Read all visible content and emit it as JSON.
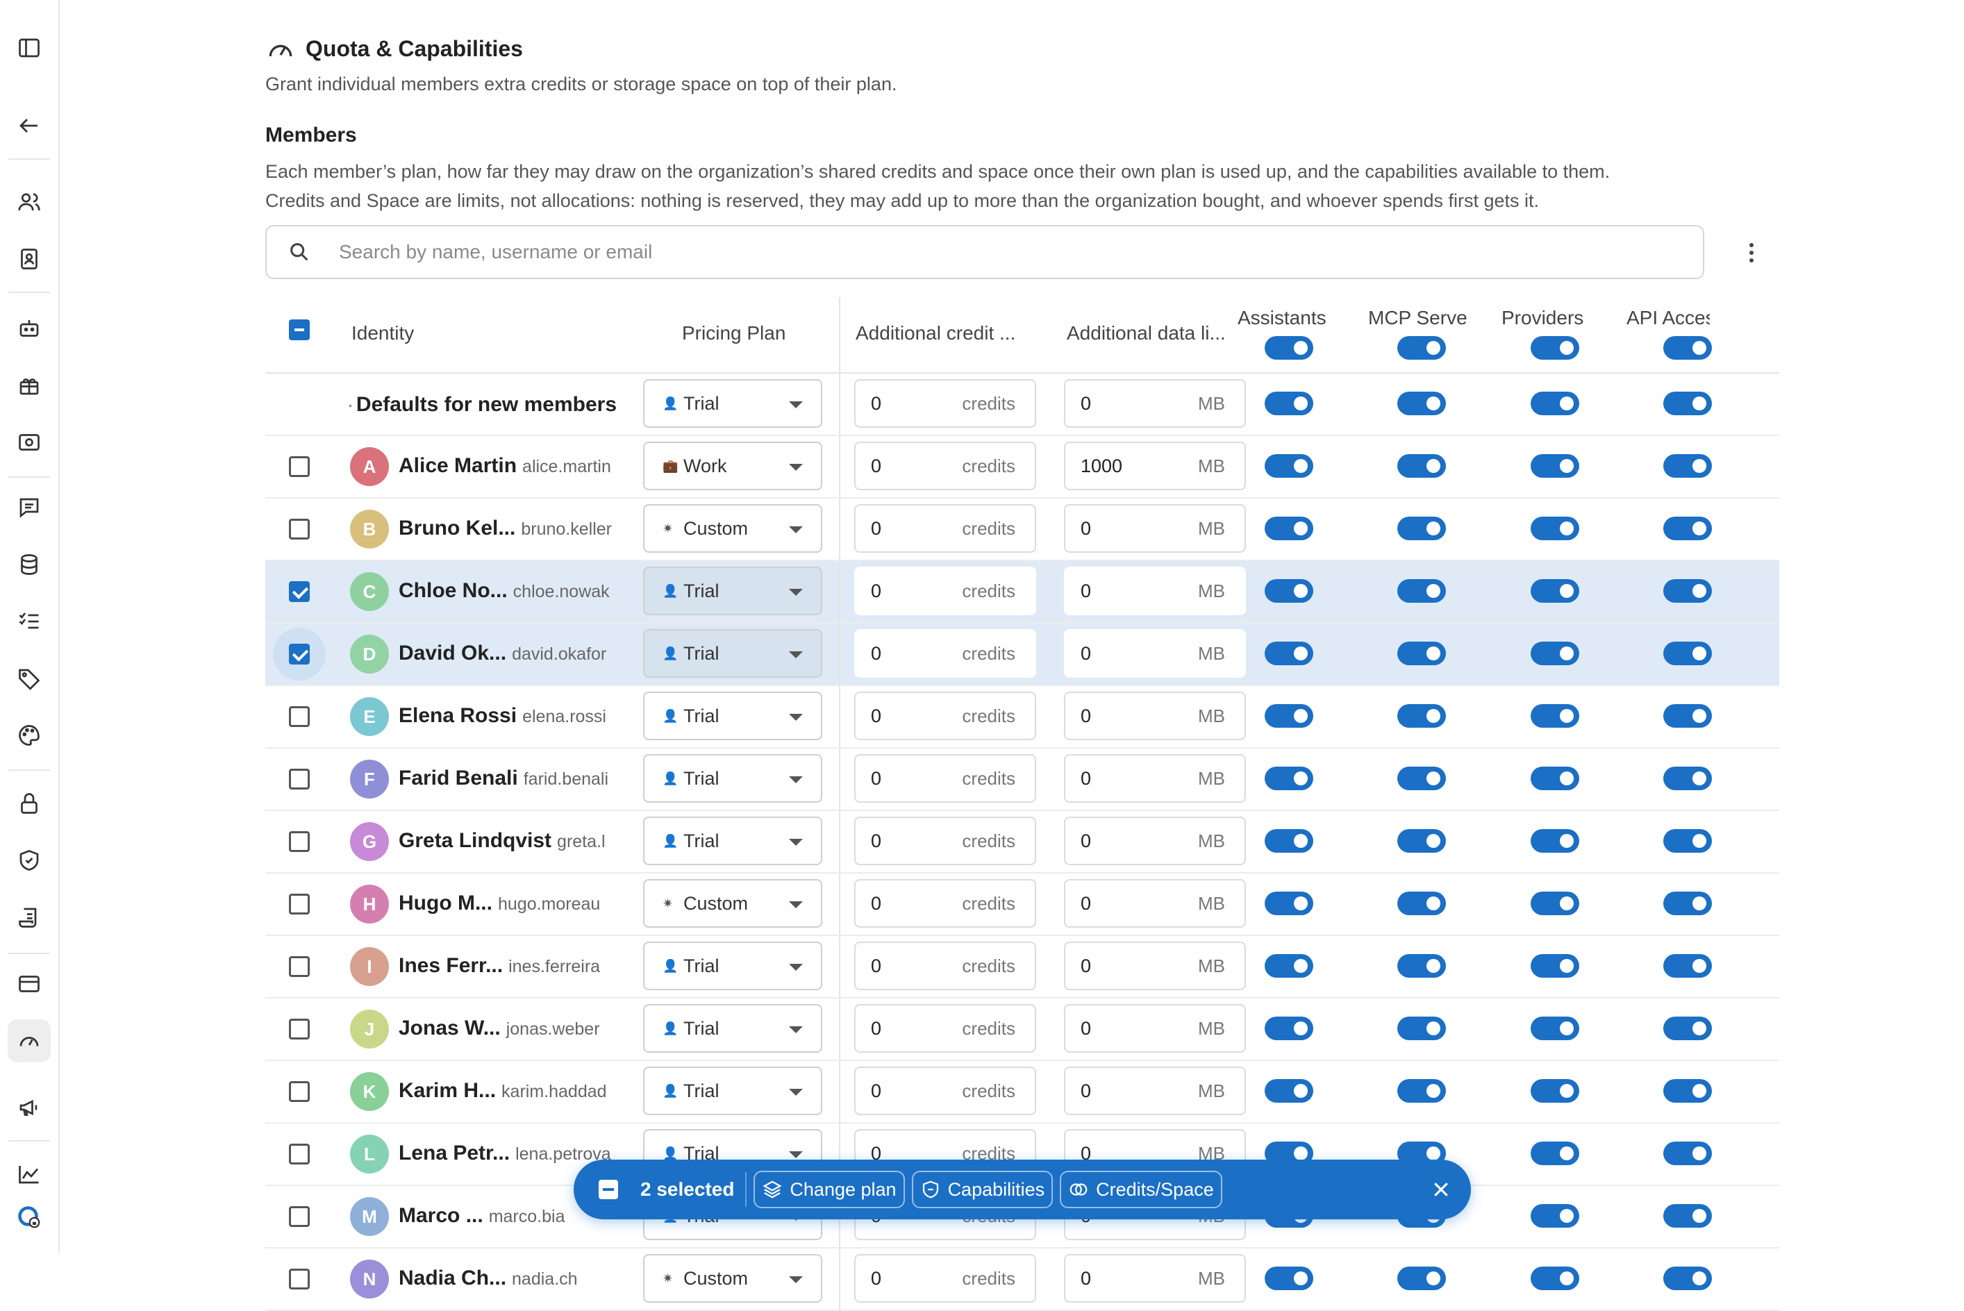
{
  "section": {
    "title": "Quota & Capabilities",
    "description": "Grant individual members extra credits or storage space on top of their plan."
  },
  "members": {
    "title": "Members",
    "desc_line1": "Each member’s plan, how far they may draw on the organization’s shared credits and space once their own plan is used up, and the capabilities available to them.",
    "desc_line2": "Credits and Space are limits, not allocations: nothing is reserved, they may add up to more than the organization bought, and whoever spends first gets it."
  },
  "search": {
    "placeholder": "Search by name, username or email"
  },
  "columns": {
    "identity": "Identity",
    "plan": "Pricing Plan",
    "credits": "Additional credit ...",
    "data": "Additional data li...",
    "assistants": "Assistants",
    "mcp": "MCP Serve",
    "providers": "Providers",
    "api": "API Acces:"
  },
  "defaults_row": {
    "label": "Defaults for new members",
    "plan": "Trial",
    "credits": "0",
    "data": "0"
  },
  "units": {
    "credits": "credits",
    "data": "MB"
  },
  "rows": [
    {
      "initial": "A",
      "name": "Alice Martin",
      "username": "alice.martin",
      "plan": "Work",
      "credits": "0",
      "data": "1000",
      "color": "#d9727a",
      "checked": false
    },
    {
      "initial": "B",
      "name": "Bruno Kel...",
      "username": "bruno.keller",
      "plan": "Custom",
      "credits": "0",
      "data": "0",
      "color": "#d8c07c",
      "checked": false
    },
    {
      "initial": "C",
      "name": "Chloe No...",
      "username": "chloe.nowak",
      "plan": "Trial",
      "credits": "0",
      "data": "0",
      "color": "#8fd0a0",
      "checked": true
    },
    {
      "initial": "D",
      "name": "David Ok...",
      "username": "david.okafor",
      "plan": "Trial",
      "credits": "0",
      "data": "0",
      "color": "#92d3a3",
      "checked": true
    },
    {
      "initial": "E",
      "name": "Elena Rossi",
      "username": "elena.rossi",
      "plan": "Trial",
      "credits": "0",
      "data": "0",
      "color": "#7cc8d2",
      "checked": false
    },
    {
      "initial": "F",
      "name": "Farid Benali",
      "username": "farid.benali",
      "plan": "Trial",
      "credits": "0",
      "data": "0",
      "color": "#8e8fd6",
      "checked": false
    },
    {
      "initial": "G",
      "name": "Greta Lindqvist",
      "username": "greta.l",
      "plan": "Trial",
      "credits": "0",
      "data": "0",
      "color": "#c78ad6",
      "checked": false
    },
    {
      "initial": "H",
      "name": "Hugo M...",
      "username": "hugo.moreau",
      "plan": "Custom",
      "credits": "0",
      "data": "0",
      "color": "#d57fb1",
      "checked": false
    },
    {
      "initial": "I",
      "name": "Ines Ferr...",
      "username": "ines.ferreira",
      "plan": "Trial",
      "credits": "0",
      "data": "0",
      "color": "#d8a08e",
      "checked": false
    },
    {
      "initial": "J",
      "name": "Jonas W...",
      "username": "jonas.weber",
      "plan": "Trial",
      "credits": "0",
      "data": "0",
      "color": "#c8d888",
      "checked": false
    },
    {
      "initial": "K",
      "name": "Karim H...",
      "username": "karim.haddad",
      "plan": "Trial",
      "credits": "0",
      "data": "0",
      "color": "#88cf98",
      "checked": false
    },
    {
      "initial": "L",
      "name": "Lena Petr...",
      "username": "lena.petrova",
      "plan": "Trial",
      "credits": "0",
      "data": "0",
      "color": "#86d2b6",
      "checked": false
    },
    {
      "initial": "M",
      "name": "Marco ...",
      "username": "marco.bia",
      "plan": "Trial",
      "credits": "0",
      "data": "0",
      "color": "#8fb0d8",
      "checked": false
    },
    {
      "initial": "N",
      "name": "Nadia Ch...",
      "username": "nadia.ch",
      "plan": "Custom",
      "credits": "0",
      "data": "0",
      "color": "#9a8fd8",
      "checked": false
    }
  ],
  "action_bar": {
    "count": "2 selected",
    "change_plan": "Change plan",
    "capabilities": "Capabilities",
    "credits_space": "Credits/Space"
  },
  "colors": {
    "accent": "#1b6fc5",
    "selected_row": "#dfeaf6"
  }
}
